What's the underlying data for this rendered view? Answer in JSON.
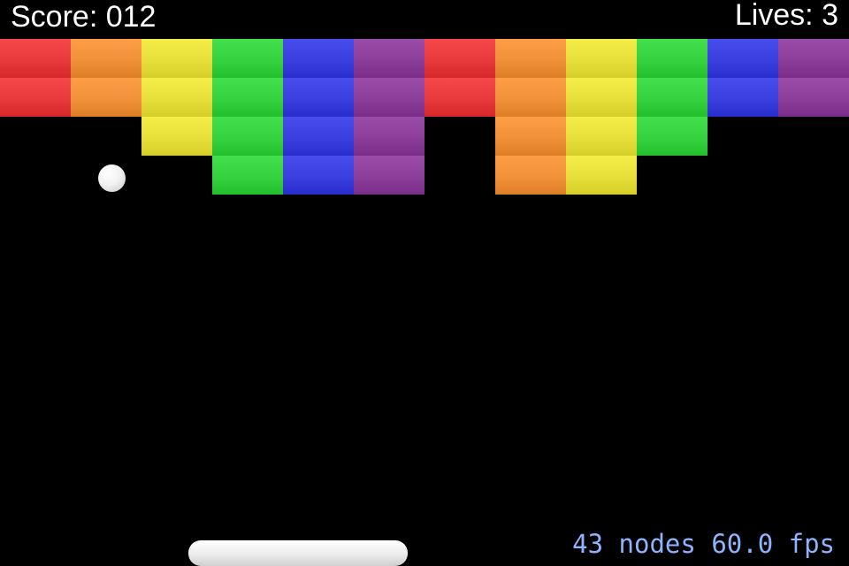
{
  "hud": {
    "score_label": "Score: 012",
    "lives_label": "Lives: 3"
  },
  "debug": {
    "nodes_text": "43 nodes",
    "fps_text": "60.0 fps"
  },
  "palette": {
    "red": "#e8393c",
    "orange": "#f0913a",
    "yellow": "#e7e03a",
    "green": "#36d13f",
    "blue": "#3b3fe0",
    "purple": "#8c3f9a"
  },
  "bricks": {
    "rows": [
      [
        "red",
        "orange",
        "yellow",
        "green",
        "blue",
        "purple",
        "red",
        "orange",
        "yellow",
        "green",
        "blue",
        "purple"
      ],
      [
        "red",
        "orange",
        "yellow",
        "green",
        "blue",
        "purple",
        "red",
        "orange",
        "yellow",
        "green",
        "blue",
        "purple"
      ],
      [
        null,
        null,
        "yellow",
        "green",
        "blue",
        "purple",
        null,
        "orange",
        "yellow",
        "green",
        null,
        null
      ],
      [
        null,
        null,
        null,
        "green",
        "blue",
        "purple",
        null,
        "orange",
        "yellow",
        null,
        null,
        null
      ]
    ]
  }
}
